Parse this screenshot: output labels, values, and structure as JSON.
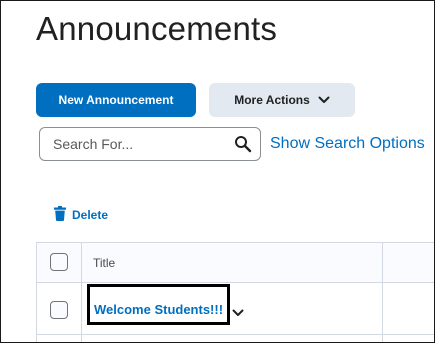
{
  "header": {
    "title": "Announcements"
  },
  "toolbar": {
    "new_label": "New Announcement",
    "more_label": "More Actions"
  },
  "search": {
    "placeholder": "Search For...",
    "value": "",
    "options_label": "Show Search Options"
  },
  "actions": {
    "delete_label": "Delete"
  },
  "table": {
    "columns": [
      "Title"
    ],
    "rows": [
      {
        "title": "Welcome Students!!!",
        "highlighted": true
      }
    ]
  },
  "icons": {
    "search": "search-icon",
    "delete": "trash-icon",
    "more_actions": "chevron-down-icon",
    "row_menu": "chevron-down-icon"
  },
  "colors": {
    "accent": "#006fbf",
    "secondary_button": "#e3e9f1",
    "text": "#202122",
    "highlight_border": "#000000"
  }
}
